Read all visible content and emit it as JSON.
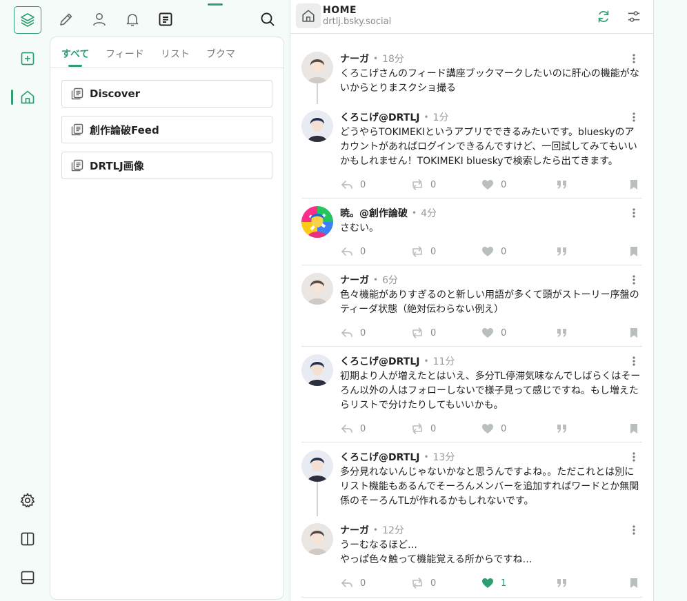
{
  "colors": {
    "accent": "#2e9e70",
    "icon": "#444444",
    "muted": "#b9bfbc"
  },
  "rail": {
    "icons": [
      "layers-icon",
      "add-column-icon",
      "home-icon",
      "gear-icon",
      "columns-icon",
      "bottom-panel-icon"
    ]
  },
  "topbar": {
    "icons": [
      "pencil-icon",
      "user-icon",
      "bell-icon",
      "list-doc-icon",
      "search-icon"
    ],
    "active": "list-doc-icon"
  },
  "panel": {
    "tabs": [
      {
        "label": "すべて",
        "active": true
      },
      {
        "label": "フィード",
        "active": false
      },
      {
        "label": "リスト",
        "active": false
      },
      {
        "label": "ブクマ",
        "active": false
      }
    ],
    "feeds": [
      {
        "label": "Discover"
      },
      {
        "label": "創作論破Feed"
      },
      {
        "label": "DRTLJ画像"
      }
    ]
  },
  "timeline": {
    "title": "HOME",
    "account": "drtlj.bsky.social",
    "posts": [
      {
        "name": "ナーガ",
        "time": "18分",
        "text": "くろこげさんのフィード講座ブックマークしたいのに肝心の機能がないからとりまスクショ撮る",
        "actions": null
      },
      {
        "name": "くろこげ@DRTLJ",
        "time": "1分",
        "text": "どうやらTOKIMEKIというアプリでできるみたいです。blueskyのアカウントがあればログインできるんですけど、一回試してみてもいいかもしれません！TOKIMEKI blueskyで検索したら出てきます。",
        "actions": {
          "reply": "0",
          "repost": "0",
          "like": "0",
          "liked": false
        }
      },
      {
        "name": "暁。@創作論破",
        "time": "4分",
        "text": "さむい。",
        "actions": {
          "reply": "0",
          "repost": "0",
          "like": "0",
          "liked": false
        }
      },
      {
        "name": "ナーガ",
        "time": "6分",
        "text": "色々機能がありすぎるのと新しい用語が多くて頭がストーリー序盤のティーダ状態（絶対伝わらない例え）",
        "actions": {
          "reply": "0",
          "repost": "0",
          "like": "0",
          "liked": false
        }
      },
      {
        "name": "くろこげ@DRTLJ",
        "time": "11分",
        "text": "初期より人が増えたとはいえ、多分TL停滞気味なんでしばらくはそーろん以外の人はフォローしないで様子見って感じですね。もし増えたらリストで分けたりしてもいいかも。",
        "actions": {
          "reply": "0",
          "repost": "0",
          "like": "0",
          "liked": false
        }
      },
      {
        "name": "くろこげ@DRTLJ",
        "time": "13分",
        "text": "多分見れないんじゃないかなと思うんですよね。。ただこれとは別にリスト機能もあるんでそーろんメンバーを追加すればワードとか無関係のそーろんTLが作れるかもしれないです。",
        "actions": null
      },
      {
        "name": "ナーガ",
        "time": "12分",
        "text": "うーむなるほど…\nやっぱ色々触って機能覚える所からですね…",
        "actions": {
          "reply": "0",
          "repost": "0",
          "like": "1",
          "liked": true
        }
      }
    ]
  }
}
